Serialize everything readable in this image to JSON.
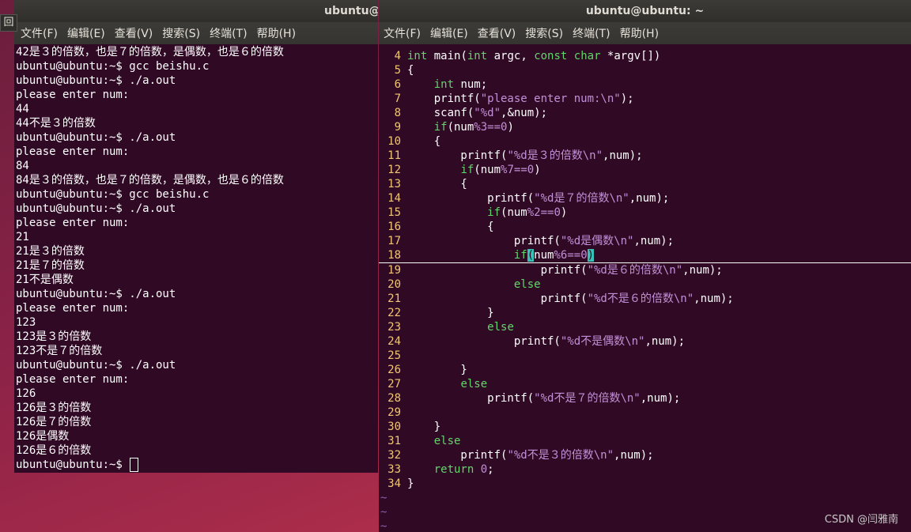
{
  "left_window": {
    "title": "ubuntu@",
    "restore_button": "回",
    "menu": [
      "文件(F)",
      "编辑(E)",
      "查看(V)",
      "搜索(S)",
      "终端(T)",
      "帮助(H)"
    ],
    "lines": [
      "42是３的倍数，也是７的倍数，是偶数，也是６的倍数",
      "ubuntu@ubuntu:~$ gcc beishu.c",
      "ubuntu@ubuntu:~$ ./a.out",
      "please enter num:",
      "44",
      "44不是３的倍数",
      "ubuntu@ubuntu:~$ ./a.out",
      "please enter num:",
      "84",
      "84是３的倍数，也是７的倍数，是偶数，也是６的倍数",
      "ubuntu@ubuntu:~$ gcc beishu.c",
      "ubuntu@ubuntu:~$ ./a.out",
      "please enter num:",
      "21",
      "21是３的倍数",
      "21是７的倍数",
      "21不是偶数",
      "ubuntu@ubuntu:~$ ./a.out",
      "please enter num:",
      "123",
      "123是３的倍数",
      "123不是７的倍数",
      "ubuntu@ubuntu:~$ ./a.out",
      "please enter num:",
      "126",
      "126是３的倍数",
      "126是７的倍数",
      "126是偶数",
      "126是６的倍数"
    ],
    "prompt": "ubuntu@ubuntu:~$ "
  },
  "right_window": {
    "title": "ubuntu@ubuntu: ~",
    "menu": [
      "文件(F)",
      "编辑(E)",
      "查看(V)",
      "搜索(S)",
      "终端(T)",
      "帮助(H)"
    ],
    "code_lines": [
      {
        "n": "4",
        "t": "int main(int argc, const char *argv[])"
      },
      {
        "n": "5",
        "t": "{"
      },
      {
        "n": "6",
        "t": "    int num;"
      },
      {
        "n": "7",
        "t": "    printf(\"please enter num:\\n\");"
      },
      {
        "n": "8",
        "t": "    scanf(\"%d\",&num);"
      },
      {
        "n": "9",
        "t": "    if(num%3==0)"
      },
      {
        "n": "10",
        "t": "    {"
      },
      {
        "n": "11",
        "t": "        printf(\"%d是３的倍数\\n\",num);"
      },
      {
        "n": "12",
        "t": "        if(num%7==0)"
      },
      {
        "n": "13",
        "t": "        {"
      },
      {
        "n": "14",
        "t": "            printf(\"%d是７的倍数\\n\",num);"
      },
      {
        "n": "15",
        "t": "            if(num%2==0)"
      },
      {
        "n": "16",
        "t": "            {"
      },
      {
        "n": "17",
        "t": "                printf(\"%d是偶数\\n\",num);"
      },
      {
        "n": "18",
        "t": "                if(num%6==0)"
      },
      {
        "n": "19",
        "t": "                    printf(\"%d是６的倍数\\n\",num);"
      },
      {
        "n": "20",
        "t": "                else"
      },
      {
        "n": "21",
        "t": "                    printf(\"%d不是６的倍数\\n\",num);"
      },
      {
        "n": "22",
        "t": "            }"
      },
      {
        "n": "23",
        "t": "            else"
      },
      {
        "n": "24",
        "t": "                printf(\"%d不是偶数\\n\",num);"
      },
      {
        "n": "25",
        "t": ""
      },
      {
        "n": "26",
        "t": "        }"
      },
      {
        "n": "27",
        "t": "        else"
      },
      {
        "n": "28",
        "t": "            printf(\"%d不是７的倍数\\n\",num);"
      },
      {
        "n": "29",
        "t": ""
      },
      {
        "n": "30",
        "t": "    }"
      },
      {
        "n": "31",
        "t": "    else"
      },
      {
        "n": "32",
        "t": "        printf(\"%d不是３的倍数\\n\",num);"
      },
      {
        "n": "33",
        "t": "    return 0;"
      },
      {
        "n": "34",
        "t": "}"
      }
    ],
    "cursor_line": "18",
    "tildes": [
      "~",
      "~",
      "~"
    ]
  },
  "watermark": "CSDN @闫雅南",
  "colors": {
    "terminal_bg": "#300a24",
    "keyword": "#62d66b",
    "string": "#c38fd8",
    "line_number": "#f0c674",
    "tilde": "#8a5fb0"
  }
}
